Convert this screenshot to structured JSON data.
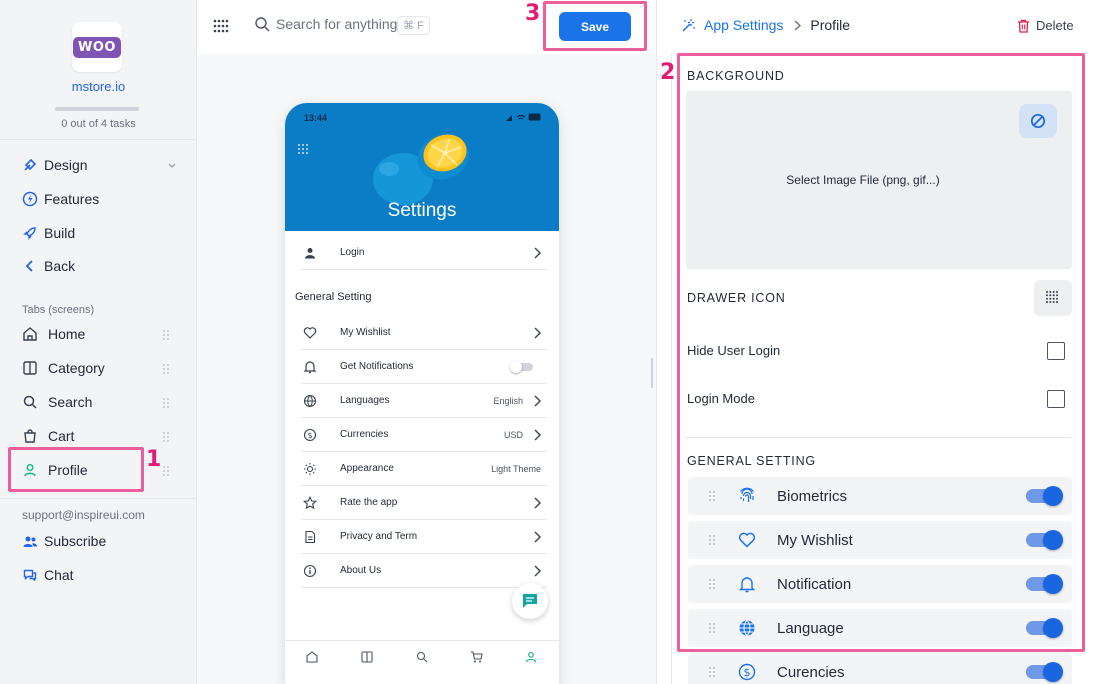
{
  "store": {
    "logo_text": "WOO",
    "name": "mstore.io",
    "tasks_done": 0,
    "tasks_total": 4,
    "progress_text": "0 out of 4 tasks"
  },
  "sidebar": {
    "main_items": [
      {
        "label": "Design",
        "icon": "brush-icon"
      },
      {
        "label": "Features",
        "icon": "bolt-icon"
      },
      {
        "label": "Build",
        "icon": "rocket-icon"
      },
      {
        "label": "Back",
        "icon": "chevron-left-icon"
      }
    ],
    "tabs_heading": "Tabs (screens)",
    "tabs": [
      {
        "label": "Home",
        "icon": "home-icon"
      },
      {
        "label": "Category",
        "icon": "book-icon"
      },
      {
        "label": "Search",
        "icon": "search-icon"
      },
      {
        "label": "Cart",
        "icon": "cart-icon"
      },
      {
        "label": "Profile",
        "icon": "user-icon",
        "active": true
      }
    ],
    "support_email": "support@inspireui.com",
    "footer_items": [
      {
        "label": "Subscribe",
        "icon": "subscribe-icon"
      },
      {
        "label": "Chat",
        "icon": "chat-icon"
      }
    ]
  },
  "topbar": {
    "search_placeholder": "Search for anything",
    "shortcut": "⌘ F",
    "save_label": "Save"
  },
  "annotations": [
    "1",
    "2",
    "3"
  ],
  "phone": {
    "time": "13:44",
    "hero_title": "Settings",
    "login_label": "Login",
    "section_heading": "General Setting",
    "rows": [
      {
        "label": "My Wishlist",
        "icon": "heart-icon",
        "value": ""
      },
      {
        "label": "Get Notifications",
        "icon": "bell-icon",
        "value": ""
      },
      {
        "label": "Languages",
        "icon": "globe-icon",
        "value": "English"
      },
      {
        "label": "Currencies",
        "icon": "dollar-icon",
        "value": "USD"
      },
      {
        "label": "Appearance",
        "icon": "sun-icon",
        "value": "Light Theme"
      },
      {
        "label": "Rate the app",
        "icon": "star-icon",
        "value": ""
      },
      {
        "label": "Privacy and Term",
        "icon": "document-icon",
        "value": ""
      },
      {
        "label": "About Us",
        "icon": "info-icon",
        "value": ""
      }
    ]
  },
  "right_panel": {
    "breadcrumb_app": "App Settings",
    "breadcrumb_page": "Profile",
    "delete_label": "Delete",
    "background_label": "BACKGROUND",
    "select_image_text": "Select Image File (png, gif...)",
    "drawer_icon_label": "DRAWER ICON",
    "hide_user_login_label": "Hide User Login",
    "hide_user_login_checked": false,
    "login_mode_label": "Login Mode",
    "login_mode_checked": false,
    "general_setting_label": "GENERAL SETTING",
    "general_items": [
      {
        "label": "Biometrics",
        "icon": "fingerprint-icon",
        "enabled": true
      },
      {
        "label": "My Wishlist",
        "icon": "heart-icon",
        "enabled": true
      },
      {
        "label": "Notification",
        "icon": "bell-icon",
        "enabled": true
      },
      {
        "label": "Language",
        "icon": "globe-icon",
        "enabled": true
      },
      {
        "label": "Curencies",
        "icon": "dollar-icon",
        "enabled": true
      }
    ]
  },
  "colors": {
    "accent": "#1a73e8",
    "annotation": "#ec5f9a",
    "active_tab": "#10b981",
    "woo_purple": "#7f54b3",
    "hero_blue": "#0b7dc6"
  }
}
